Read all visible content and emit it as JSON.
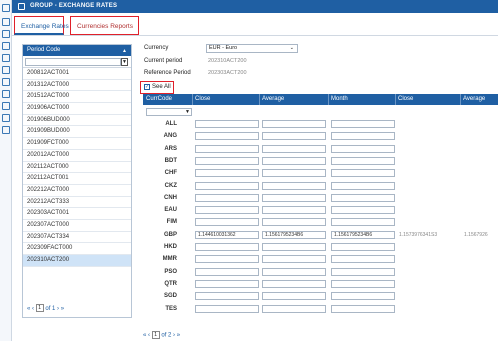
{
  "header": {
    "title": "GROUP - EXCHANGE RATES"
  },
  "tabs": [
    {
      "label": "Exchange Rates",
      "active": true
    },
    {
      "label": "Currencies Reports",
      "active": false
    }
  ],
  "rail_icons": [
    "home-icon",
    "building-icon",
    "document-icon",
    "print-icon",
    "settings-icon",
    "list-icon",
    "chart-icon",
    "transfer-icon",
    "calendar-icon",
    "tools-icon",
    "user-icon"
  ],
  "period_panel": {
    "header": "Period Code",
    "filter_value": "",
    "items": [
      "200812ACT001",
      "201312ACT000",
      "201512ACT000",
      "201906ACT000",
      "201906BUD000",
      "201909BUD000",
      "201909FCT000",
      "202012ACT000",
      "202112ACT000",
      "202112ACT001",
      "202212ACT000",
      "202212ACT333",
      "202303ACT001",
      "202307ACT000",
      "202307ACT334",
      "202309FACT000",
      "202310ACT200"
    ],
    "selected_index": 16,
    "pager": {
      "first": "«",
      "prev": "‹",
      "page": "1",
      "of": "of 1",
      "next": "›",
      "last": "»"
    }
  },
  "form": {
    "currency_label": "Currency",
    "currency_value": "EUR - Euro",
    "current_period_label": "Current period",
    "current_period_value": "202310ACT200",
    "reference_period_label": "Reference Period",
    "reference_period_value": "202303ACT200",
    "see_all_label": "See All",
    "see_all_checked": true
  },
  "grid": {
    "columns": [
      "CurrCode",
      "Close",
      "Average",
      "Month",
      "Close",
      "Average"
    ],
    "rows": [
      {
        "code": "ALL",
        "close": "",
        "average": "",
        "month": "",
        "close2": "",
        "average2": ""
      },
      {
        "code": "ANG",
        "close": "",
        "average": "",
        "month": "",
        "close2": "",
        "average2": ""
      },
      {
        "code": "ARS",
        "close": "",
        "average": "",
        "month": "",
        "close2": "",
        "average2": ""
      },
      {
        "code": "BDT",
        "close": "",
        "average": "",
        "month": "",
        "close2": "",
        "average2": ""
      },
      {
        "code": "CHF",
        "close": "",
        "average": "",
        "month": "",
        "close2": "",
        "average2": ""
      },
      {
        "code": "CKZ",
        "close": "",
        "average": "",
        "month": "",
        "close2": "",
        "average2": ""
      },
      {
        "code": "CNH",
        "close": "",
        "average": "",
        "month": "",
        "close2": "",
        "average2": ""
      },
      {
        "code": "EAU",
        "close": "",
        "average": "",
        "month": "",
        "close2": "",
        "average2": ""
      },
      {
        "code": "FIM",
        "close": "",
        "average": "",
        "month": "",
        "close2": "",
        "average2": ""
      },
      {
        "code": "GBP",
        "close": "1.144610031362",
        "average": "1.1561795234B6",
        "month": "1.1561795234B6",
        "close2": "1.1573976341S3",
        "average2": "1.1567926"
      },
      {
        "code": "HKD",
        "close": "",
        "average": "",
        "month": "",
        "close2": "",
        "average2": ""
      },
      {
        "code": "MMR",
        "close": "",
        "average": "",
        "month": "",
        "close2": "",
        "average2": ""
      },
      {
        "code": "PSO",
        "close": "",
        "average": "",
        "month": "",
        "close2": "",
        "average2": ""
      },
      {
        "code": "QTR",
        "close": "",
        "average": "",
        "month": "",
        "close2": "",
        "average2": ""
      },
      {
        "code": "SGD",
        "close": "",
        "average": "",
        "month": "",
        "close2": "",
        "average2": ""
      },
      {
        "code": "TES",
        "close": "",
        "average": "",
        "month": "",
        "close2": "",
        "average2": ""
      }
    ],
    "pager": {
      "first": "«",
      "prev": "‹",
      "page": "1",
      "of": "of 2",
      "next": "›",
      "last": "»"
    }
  }
}
